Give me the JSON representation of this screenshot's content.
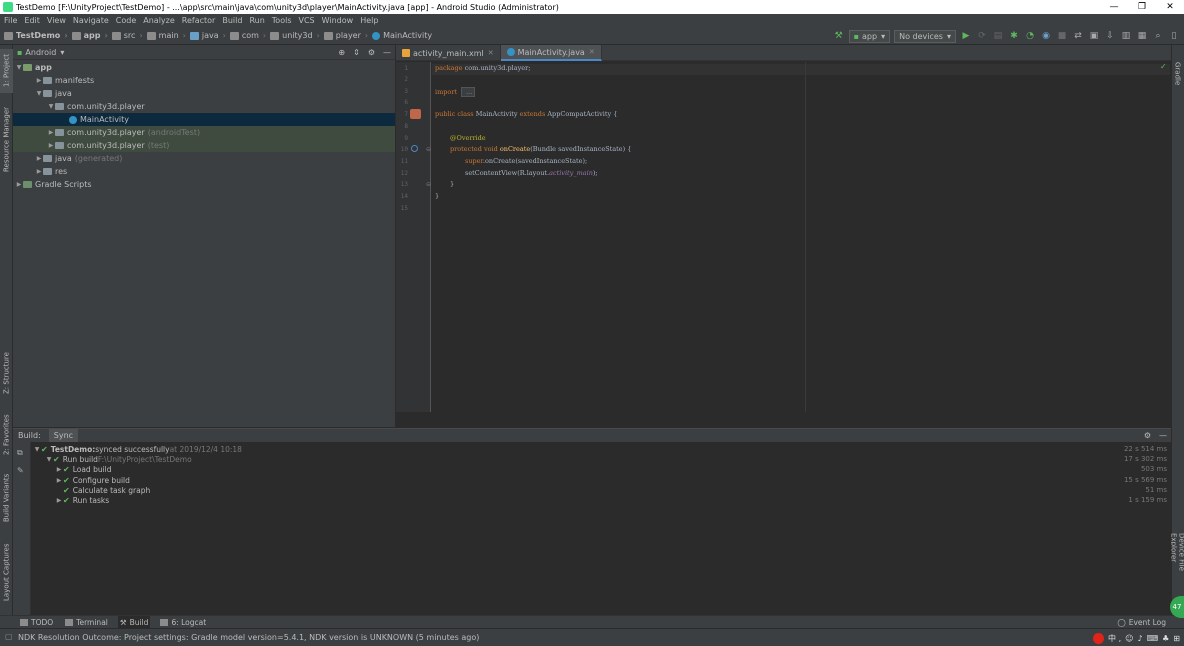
{
  "window": {
    "title": "TestDemo [F:\\UnityProject\\TestDemo] - ...\\app\\src\\main\\java\\com\\unity3d\\player\\MainActivity.java [app] - Android Studio (Administrator)",
    "minimize": "—",
    "maximize": "❐",
    "close": "✕"
  },
  "menu": [
    "File",
    "Edit",
    "View",
    "Navigate",
    "Code",
    "Analyze",
    "Refactor",
    "Build",
    "Run",
    "Tools",
    "VCS",
    "Window",
    "Help"
  ],
  "breadcrumbs": [
    "TestDemo",
    "app",
    "src",
    "main",
    "java",
    "com",
    "unity3d",
    "player",
    "MainActivity"
  ],
  "toolbar": {
    "config": "app",
    "devices": "No devices"
  },
  "left_strip": {
    "project": "1: Project",
    "resource_manager": "Resource Manager",
    "structure": "Z: Structure",
    "favorites": "2: Favorites",
    "build_variants": "Build Variants",
    "layout_captures": "Layout Captures"
  },
  "right_strip": {
    "gradle": "Gradle",
    "device_file_explorer": "Device File Explorer"
  },
  "project": {
    "view": "Android",
    "tree": [
      {
        "label": "app",
        "extra": "",
        "type": "module"
      },
      {
        "label": "manifests",
        "extra": "",
        "type": "folder"
      },
      {
        "label": "java",
        "extra": "",
        "type": "folder"
      },
      {
        "label": "com.unity3d.player",
        "extra": "",
        "type": "package"
      },
      {
        "label": "MainActivity",
        "extra": "",
        "type": "class"
      },
      {
        "label": "com.unity3d.player",
        "extra": "(androidTest)",
        "type": "package"
      },
      {
        "label": "com.unity3d.player",
        "extra": "(test)",
        "type": "package"
      },
      {
        "label": "java",
        "extra": "(generated)",
        "type": "folder"
      },
      {
        "label": "res",
        "extra": "",
        "type": "folder"
      },
      {
        "label": "Gradle Scripts",
        "extra": "",
        "type": "gradle"
      }
    ]
  },
  "editor": {
    "tabs": [
      {
        "label": "activity_main.xml",
        "active": false
      },
      {
        "label": "MainActivity.java",
        "active": true
      }
    ],
    "line_numbers": [
      "1",
      "2",
      "3",
      "6",
      "7",
      "8",
      "9",
      "10",
      "11",
      "12",
      "13",
      "14",
      "15"
    ],
    "code": {
      "l1_kw": "package",
      "l1_rest": " com.unity3d.player;",
      "l3_kw": "import",
      "l3_rest": " ...",
      "l7_kw1": "public class",
      "l7_mid": " MainActivity ",
      "l7_kw2": "extends",
      "l7_rest": " AppCompatActivity {",
      "l9_an": "@Override",
      "l10_kw": "protected void",
      "l10_fn": " onCreate",
      "l10_rest": "(Bundle savedInstanceState) {",
      "l11_kw": "super",
      "l11_rest": ".onCreate(savedInstanceState);",
      "l12_pre": "setContentView(R.layout.",
      "l12_fld": "activity_main",
      "l12_post": ");",
      "l13": "}",
      "l14": "}"
    }
  },
  "build": {
    "label": "Build:",
    "tab": "Sync",
    "rows": [
      {
        "text": "TestDemo:",
        "bold": true,
        "detail": " synced successfully",
        "dim": " at 2019/12/4 10:18",
        "time": "22 s 514 ms"
      },
      {
        "text": "Run build",
        "bold": false,
        "detail": "",
        "dim": " F:\\UnityProject\\TestDemo",
        "time": "17 s 302 ms"
      },
      {
        "text": "Load build",
        "bold": false,
        "detail": "",
        "dim": "",
        "time": "503 ms"
      },
      {
        "text": "Configure build",
        "bold": false,
        "detail": "",
        "dim": "",
        "time": "15 s 569 ms"
      },
      {
        "text": "Calculate task graph",
        "bold": false,
        "detail": "",
        "dim": "",
        "time": "51 ms"
      },
      {
        "text": "Run tasks",
        "bold": false,
        "detail": "",
        "dim": "",
        "time": "1 s 159 ms"
      }
    ]
  },
  "bottom_tabs": [
    {
      "label": "TODO",
      "active": false
    },
    {
      "label": "Terminal",
      "active": false
    },
    {
      "label": "Build",
      "active": true
    },
    {
      "label": "6: Logcat",
      "active": false
    }
  ],
  "event_log": "Event Log",
  "status": {
    "message": "NDK Resolution Outcome: Project settings: Gradle model version=5.4.1, NDK version is UNKNOWN (5 minutes ago)",
    "tray": "中 ,"
  },
  "notification_count": "47",
  "colors": {
    "background": "#2b2b2b",
    "panel": "#3c3f41",
    "keyword": "#cc7832",
    "annotation": "#bbb529",
    "function": "#ffc66d",
    "field": "#9876aa",
    "success": "#5fb760",
    "selection": "#0d293e"
  }
}
